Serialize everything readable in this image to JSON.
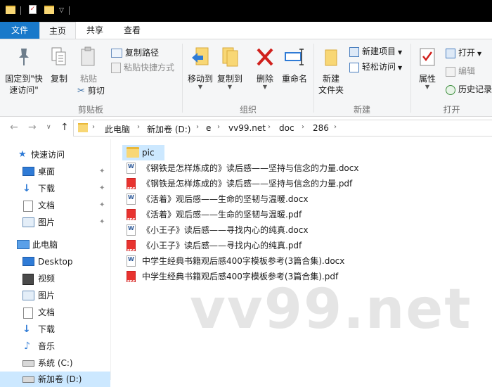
{
  "ribbon_tabs": [
    "文件",
    "主页",
    "共享",
    "查看"
  ],
  "ribbon": {
    "pin_quick_access": "固定到\"快速访问\"",
    "pin_line1": "固定到\"快",
    "pin_line2": "速访问\"",
    "copy": "复制",
    "paste": "粘贴",
    "copy_path": "复制路径",
    "paste_shortcut": "粘贴快捷方式",
    "cut": "剪切",
    "group_clipboard": "剪贴板",
    "move_to": "移动到",
    "copy_to": "复制到",
    "delete": "删除",
    "rename": "重命名",
    "group_organize": "组织",
    "new_folder_line1": "新建",
    "new_folder_line2": "文件夹",
    "new_item": "新建项目",
    "easy_access": "轻松访问",
    "group_new": "新建",
    "properties": "属性",
    "open": "打开",
    "edit": "编辑",
    "history": "历史记录",
    "group_open": "打开"
  },
  "breadcrumb": [
    "此电脑",
    "新加卷 (D:)",
    "e",
    "vv99.net",
    "doc",
    "286"
  ],
  "nav": {
    "quick_access": "快速访问",
    "quick_items": [
      "桌面",
      "下载",
      "文档",
      "图片"
    ],
    "this_pc": "此电脑",
    "pc_items": [
      "Desktop",
      "视频",
      "图片",
      "文档",
      "下载",
      "音乐",
      "系统 (C:)",
      "新加卷 (D:)"
    ]
  },
  "files": [
    {
      "name": "pic",
      "type": "folder"
    },
    {
      "name": "《钢铁是怎样炼成的》读后感——坚持与信念的力量.docx",
      "type": "docx"
    },
    {
      "name": "《钢铁是怎样炼成的》读后感——坚持与信念的力量.pdf",
      "type": "pdf"
    },
    {
      "name": "《活着》观后感——生命的坚韧与温暖.docx",
      "type": "docx"
    },
    {
      "name": "《活着》观后感——生命的坚韧与温暖.pdf",
      "type": "pdf"
    },
    {
      "name": "《小王子》读后感——寻找内心的纯真.docx",
      "type": "docx"
    },
    {
      "name": "《小王子》读后感——寻找内心的纯真.pdf",
      "type": "pdf"
    },
    {
      "name": "中学生经典书籍观后感400字模板参考(3篇合集).docx",
      "type": "docx"
    },
    {
      "name": "中学生经典书籍观后感400字模板参考(3篇合集).pdf",
      "type": "pdf"
    }
  ],
  "watermark": "vv99.net",
  "colors": {
    "file_tab": "#1979ca",
    "selection": "#cce8ff",
    "folder": "#f8d775"
  }
}
